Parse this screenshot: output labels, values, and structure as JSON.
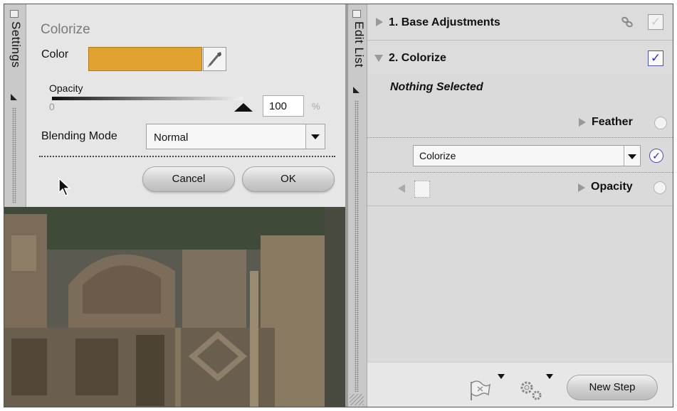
{
  "settings_panel": {
    "tab_label": "Settings",
    "title": "Colorize",
    "color_label": "Color",
    "color_value": "#E2A232",
    "opacity_label": "Opacity",
    "opacity_min": "0",
    "opacity_value": "100",
    "opacity_unit": "%",
    "blending_label": "Blending Mode",
    "blending_value": "Normal",
    "cancel_label": "Cancel",
    "ok_label": "OK"
  },
  "edit_list": {
    "tab_label": "Edit List",
    "steps": [
      {
        "title": "1. Base Adjustments",
        "expanded": false,
        "checked": false
      },
      {
        "title": "2. Colorize",
        "expanded": true,
        "checked": true
      }
    ],
    "selection_text": "Nothing Selected",
    "feather_label": "Feather",
    "sub_select_value": "Colorize",
    "opacity_label": "Opacity",
    "new_step_label": "New Step"
  },
  "icons": {
    "eyedropper": "eyedropper-icon",
    "link": "link-icon",
    "flag": "flag-icon",
    "gear": "gear-icon",
    "cursor": "cursor-icon"
  }
}
